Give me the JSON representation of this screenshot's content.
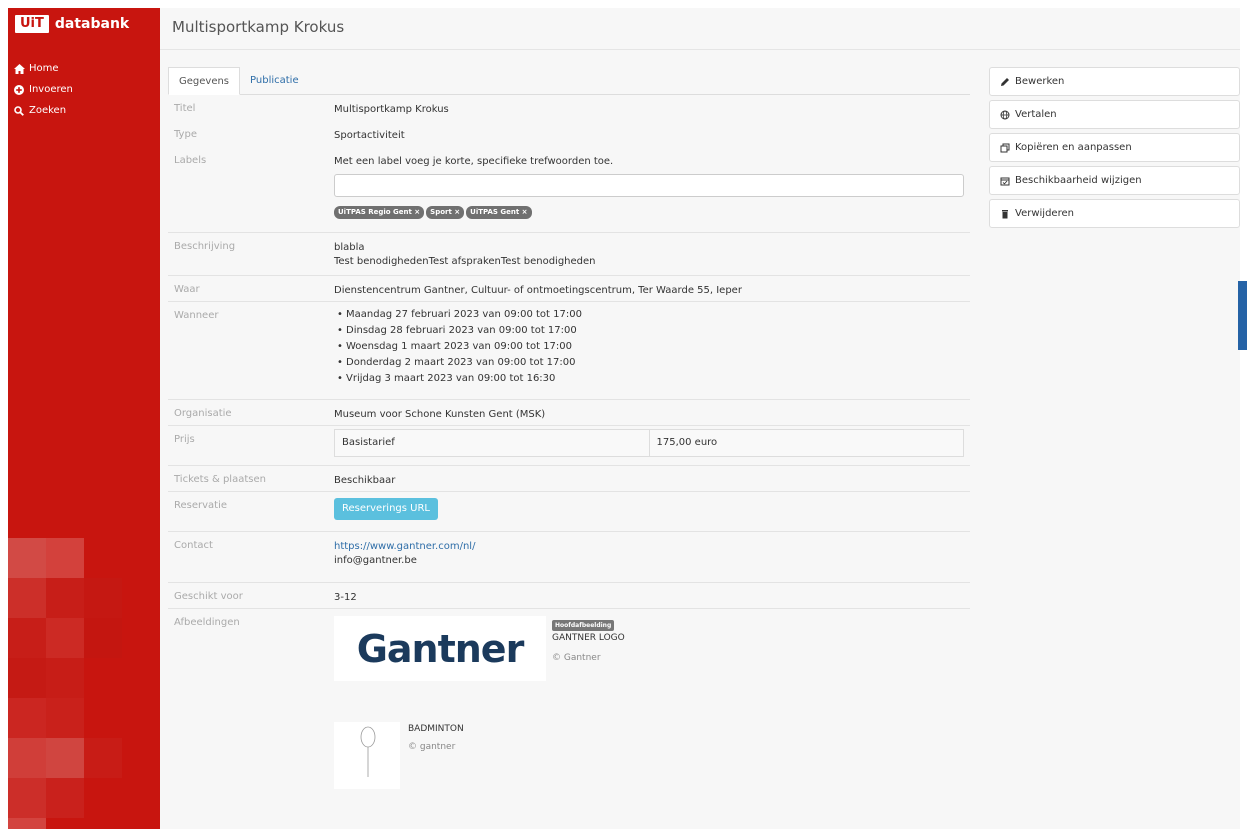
{
  "brand": {
    "box": "UiT",
    "text": "databank"
  },
  "nav": [
    {
      "label": "Home",
      "icon": "home-icon"
    },
    {
      "label": "Invoeren",
      "icon": "plus-circle-icon"
    },
    {
      "label": "Zoeken",
      "icon": "search-icon"
    }
  ],
  "page_title": "Multisportkamp Krokus",
  "tabs": [
    {
      "label": "Gegevens",
      "active": true
    },
    {
      "label": "Publicatie",
      "active": false
    }
  ],
  "fields": {
    "titel": {
      "label": "Titel",
      "value": "Multisportkamp Krokus"
    },
    "type": {
      "label": "Type",
      "value": "Sportactiviteit"
    },
    "labels": {
      "label": "Labels",
      "hint": "Met een label voeg je korte, specifieke trefwoorden toe.",
      "input_value": "",
      "chips": [
        "UiTPAS Regio Gent ×",
        "Sport ×",
        "UiTPAS Gent ×"
      ]
    },
    "beschrijving": {
      "label": "Beschrijving",
      "line1": "blabla",
      "line2": "Test benodighedenTest afsprakenTest benodigheden"
    },
    "waar": {
      "label": "Waar",
      "value": "Dienstencentrum Gantner, Cultuur- of ontmoetingscentrum, Ter Waarde 55, Ieper"
    },
    "wanneer": {
      "label": "Wanneer",
      "dates": [
        "Maandag 27 februari 2023 van 09:00 tot 17:00",
        "Dinsdag 28 februari 2023 van 09:00 tot 17:00",
        "Woensdag 1 maart 2023 van 09:00 tot 17:00",
        "Donderdag 2 maart 2023 van 09:00 tot 17:00",
        "Vrijdag 3 maart 2023 van 09:00 tot 16:30"
      ]
    },
    "organisatie": {
      "label": "Organisatie",
      "value": "Museum voor Schone Kunsten Gent (MSK)"
    },
    "prijs": {
      "label": "Prijs",
      "name": "Basistarief",
      "amount": "175,00 euro"
    },
    "tickets": {
      "label": "Tickets & plaatsen",
      "value": "Beschikbaar"
    },
    "reservatie": {
      "label": "Reservatie",
      "button": "Reserverings URL"
    },
    "contact": {
      "label": "Contact",
      "url": "https://www.gantner.com/nl/",
      "email": "info@gantner.be"
    },
    "geschikt": {
      "label": "Geschikt voor",
      "value": "3-12"
    },
    "afbeeldingen": {
      "label": "Afbeeldingen",
      "images": [
        {
          "logo_text": "Gantner",
          "badge": "Hoofdafbeelding",
          "title": "GANTNER LOGO",
          "copyright": "© Gantner"
        },
        {
          "title": "BADMINTON",
          "copyright": "© gantner"
        }
      ]
    }
  },
  "actions": [
    {
      "label": "Bewerken",
      "icon": "pencil-icon"
    },
    {
      "label": "Vertalen",
      "icon": "globe-icon"
    },
    {
      "label": "Kopiëren en aanpassen",
      "icon": "copy-icon"
    },
    {
      "label": "Beschikbaarheid wijzigen",
      "icon": "calendar-check-icon"
    },
    {
      "label": "Verwijderen",
      "icon": "trash-icon"
    }
  ],
  "colors": {
    "brand_red": "#c8150f",
    "link_blue": "#2f6ea8",
    "info_button": "#5bc0de",
    "feedback_tab": "#2563a6"
  }
}
